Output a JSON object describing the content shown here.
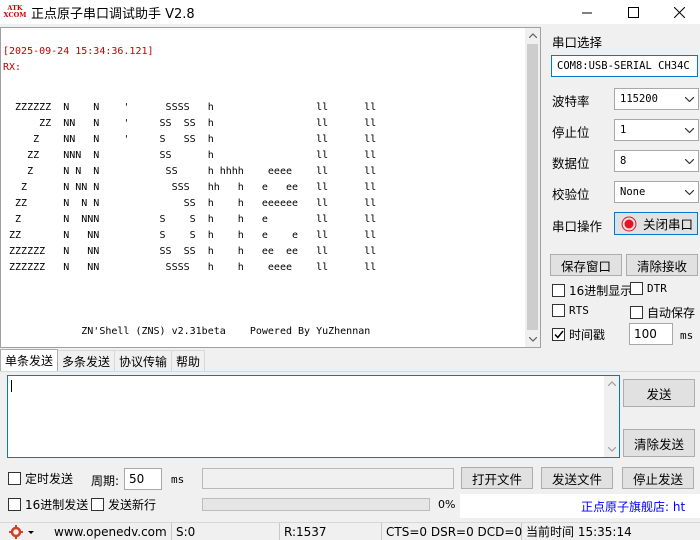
{
  "window": {
    "logo_line1": "ATK",
    "logo_line2": "XCOM",
    "title": "正点原子串口调试助手 V2.8"
  },
  "receive": {
    "timestamp": "[2025-09-24 15:34:36.121]",
    "rx_label": "RX:",
    "ascii_art": "  ZZZZZZ  N    N    '      SSSS   h                 ll      ll\n      ZZ  NN   N    '     SS  SS  h                 ll      ll\n     Z    NN   N    '     S   SS  h                 ll      ll\n    ZZ    NNN  N          SS      h                 ll      ll\n    Z     N N  N           SS     h hhhh    eeee    ll      ll\n   Z      N NN N            SSS   hh   h   e   ee   ll      ll\n  ZZ      N  N N              SS  h    h   eeeeee   ll      ll\n  Z       N  NNN          S    S  h    h   e        ll      ll\n ZZ       N   NN          S    S  h    h   e    e   ll      ll\n ZZZZZZ   N   NN          SS  SS  h    h   ee  ee   ll      ll\n ZZZZZZ   N   NN           SSSS   h    h    eeee    ll      ll\n\n\n\n             ZN'Shell (ZNS) v2.31beta    Powered By YuZhennan"
  },
  "serial_config": {
    "section_title": "串口选择",
    "port_value": "COM8:USB-SERIAL CH34C",
    "baud_label": "波特率",
    "baud_value": "115200",
    "stopbits_label": "停止位",
    "stopbits_value": "1",
    "databits_label": "数据位",
    "databits_value": "8",
    "parity_label": "校验位",
    "parity_value": "None",
    "operation_label": "串口操作",
    "close_port_label": "关闭串口"
  },
  "receive_controls": {
    "save_window_label": "保存窗口",
    "clear_receive_label": "清除接收",
    "hex_display_label": "16进制显示",
    "hex_display_checked": false,
    "dtr_label": "DTR",
    "dtr_checked": false,
    "rts_label": "RTS",
    "rts_checked": false,
    "auto_save_label": "自动保存",
    "auto_save_checked": false,
    "timestamp_label": "时间戳",
    "timestamp_checked": true,
    "timestamp_interval": "100",
    "timestamp_unit": "ms"
  },
  "tabs": [
    {
      "label": "单条发送",
      "active": true
    },
    {
      "label": "多条发送",
      "active": false
    },
    {
      "label": "协议传输",
      "active": false
    },
    {
      "label": "帮助",
      "active": false
    }
  ],
  "send": {
    "input_value": "",
    "send_label": "发送",
    "clear_send_label": "清除发送",
    "timed_send_label": "定时发送",
    "timed_send_checked": false,
    "period_label": "周期:",
    "period_value": "50",
    "period_unit": "ms",
    "open_file_label": "打开文件",
    "send_file_label": "发送文件",
    "stop_send_label": "停止发送",
    "hex_send_label": "16进制发送",
    "hex_send_checked": false,
    "newline_label": "发送新行",
    "newline_checked": false,
    "progress_percent": "0%",
    "store_link": "正点原子旗舰店: ht"
  },
  "status": {
    "website": "www.openedv.com",
    "sent": "S:0",
    "received": "R:1537",
    "lines": "CTS=0 DSR=0 DCD=0",
    "current_time": "当前时间 15:35:14"
  },
  "colors": {
    "rx_header": "#c00000",
    "accent": "#0078d7",
    "close_port_icon": "#e81123",
    "link": "#0000ff"
  }
}
